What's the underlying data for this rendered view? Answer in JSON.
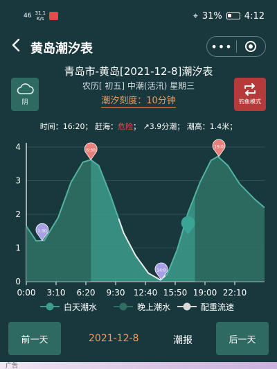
{
  "status_bar": {
    "network_left": "46",
    "network_speed_top": "31.1",
    "network_speed_bottom": "K/s",
    "battery": "31%",
    "time": "4:12"
  },
  "nav": {
    "back_icon": "chevron-left-icon",
    "title": "黄岛潮汐表",
    "more_label": "•••",
    "close_icon": "target-icon"
  },
  "weather": {
    "label": "阴",
    "icon": "cloud-icon"
  },
  "fishing_mode": {
    "label": "钓鱼模式",
    "icon": "swap-icon"
  },
  "header": {
    "title": "青岛市-黄岛[2021-12-8]潮汐表",
    "lunar": "农历[ 初五] 中潮(活汛) 星期三",
    "scale": "潮汐刻度：10分钟"
  },
  "metrics": {
    "time_label": "时间：",
    "time_value": "16:20",
    "sea_label": "赶海：",
    "sea_value": "危险",
    "trend": "↗3.9分潮",
    "height_label": "潮高：",
    "height_value": "1.4米"
  },
  "colors": {
    "background": "#19383d",
    "day_tide": "#3c9c8c",
    "night_tide": "#2f6f63",
    "current": "#e6e6e6",
    "high_marker": "#e9807a",
    "low_marker": "#a6a0e6",
    "accent": "#f29c59"
  },
  "chart_data": {
    "type": "area",
    "y_ticks": [
      "0",
      "1",
      "2",
      "3",
      "4"
    ],
    "x_ticks": [
      "0:00",
      "3:10",
      "6:20",
      "9:30",
      "12:40",
      "15:50",
      "19:00",
      "22:10"
    ],
    "ylim": [
      0,
      4
    ],
    "xlim_hours": [
      0,
      24
    ],
    "curve_hours": [
      0,
      1.0,
      1.8,
      3.2,
      4.5,
      5.7,
      6.5,
      7.3,
      8.5,
      9.8,
      11.0,
      12.3,
      13.5,
      14.2,
      15.2,
      16.3,
      17.5,
      18.6,
      19.3,
      20.3,
      21.5,
      23.0,
      24
    ],
    "curve_values": [
      1.65,
      1.21,
      1.22,
      1.9,
      2.95,
      3.55,
      3.62,
      3.45,
      2.55,
      1.45,
      0.78,
      0.25,
      0.05,
      0.22,
      0.95,
      2.05,
      2.95,
      3.6,
      3.72,
      3.45,
      2.9,
      2.45,
      2.2
    ],
    "day_start_hour": 6.5,
    "day_end_hour": 17.0,
    "markers": [
      {
        "kind": "low",
        "hour": 1.6,
        "value": 1.22,
        "label": "1:30"
      },
      {
        "kind": "high",
        "hour": 6.5,
        "value": 3.62,
        "label": "6:30"
      },
      {
        "kind": "low",
        "hour": 13.6,
        "value": 0.05,
        "label": "14:0"
      },
      {
        "kind": "high",
        "hour": 19.4,
        "value": 3.72,
        "label": "19:0"
      },
      {
        "kind": "current",
        "hour": 16.3,
        "value": 1.4,
        "label": ""
      }
    ],
    "legend": [
      {
        "name": "白天潮水",
        "color": "#3c9c8c"
      },
      {
        "name": "晚上潮水",
        "color": "#2f6f63"
      },
      {
        "name": "配重流速",
        "color": "#d9d9d9"
      }
    ]
  },
  "footer": {
    "prev": "前一天",
    "date": "2021-12-8",
    "report": "潮报",
    "next": "后一天",
    "ad": "广告"
  }
}
